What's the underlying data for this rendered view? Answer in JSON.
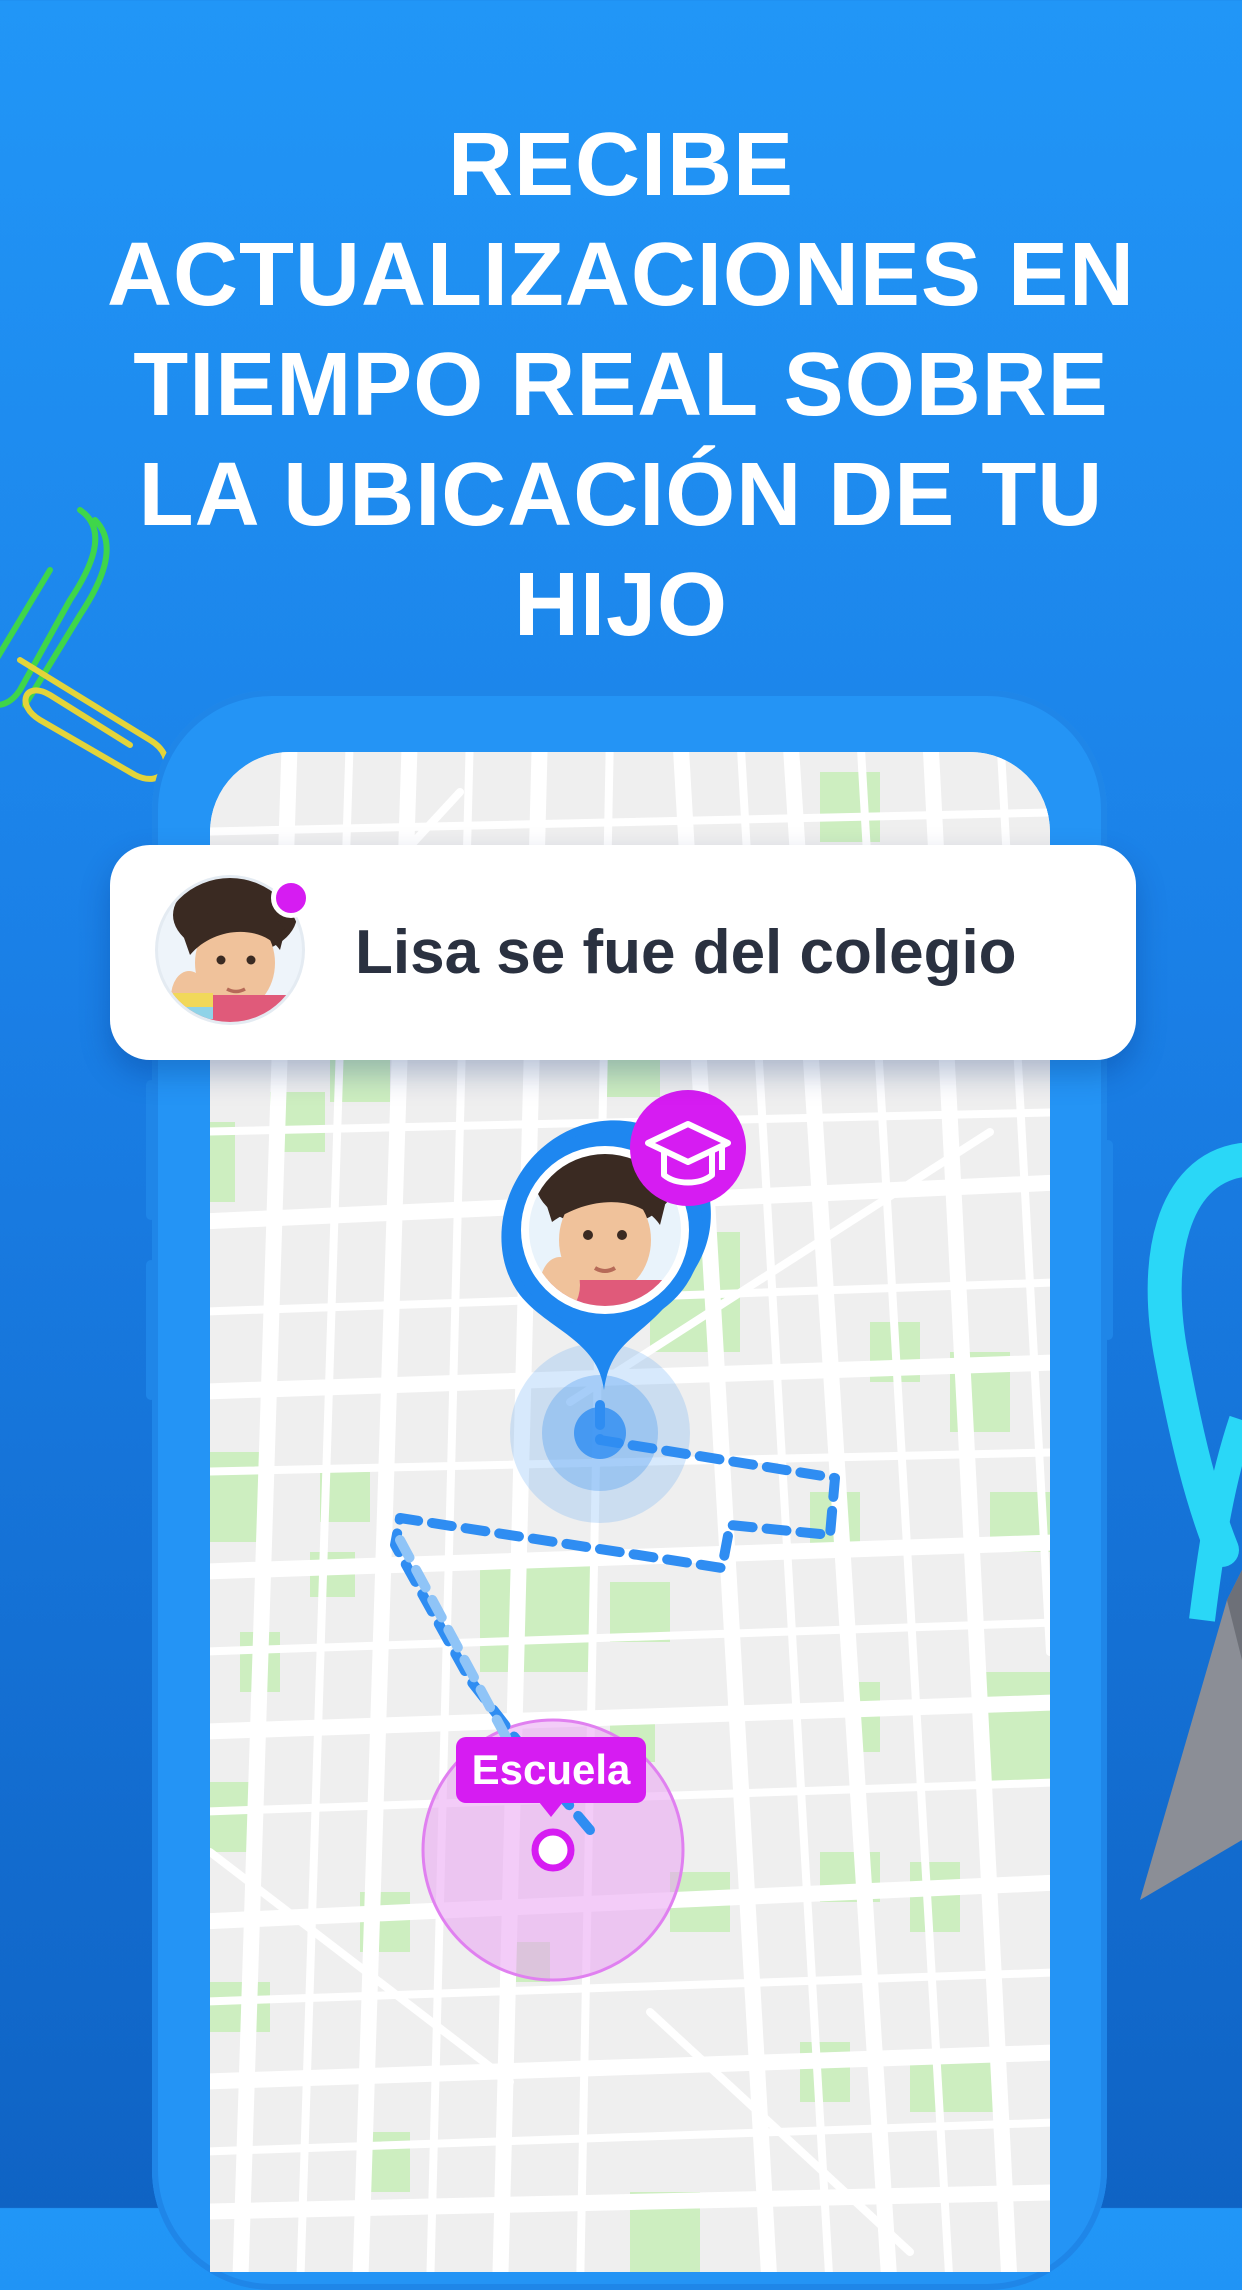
{
  "headline": "RECIBE ACTUALIZACIONES EN TIEMPO REAL SOBRE LA UBICACIÓN DE TU HIJO",
  "notification": {
    "text": "Lisa se fue del colegio",
    "avatar": "child-avatar"
  },
  "map": {
    "marker_badge_icon": "graduation-cap-icon",
    "school_label": "Escuela"
  },
  "colors": {
    "background": "#1e8cf0",
    "phone": "#2494f5",
    "accent_magenta": "#d61cf2",
    "route_blue": "#2f8df2",
    "map_green": "#cdeec0"
  }
}
